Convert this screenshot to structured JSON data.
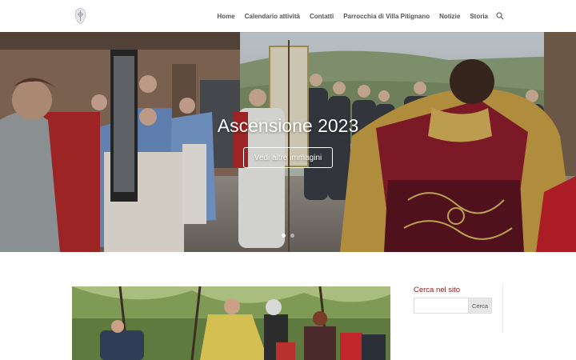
{
  "nav": {
    "items": [
      {
        "label": "Home"
      },
      {
        "label": "Calendario attività"
      },
      {
        "label": "Contatti"
      },
      {
        "label": "Parrocchia di Villa Pitignano"
      },
      {
        "label": "Notizie"
      },
      {
        "label": "Storia"
      }
    ]
  },
  "hero": {
    "title": "Ascensione 2023",
    "button_label": "Vedi altre immagini"
  },
  "sidebar": {
    "title": "Cerca nel sito",
    "search_placeholder": "",
    "search_button_label": "Cerca"
  },
  "colors": {
    "accent": "#8b1a1a",
    "nav_text": "#555555"
  }
}
